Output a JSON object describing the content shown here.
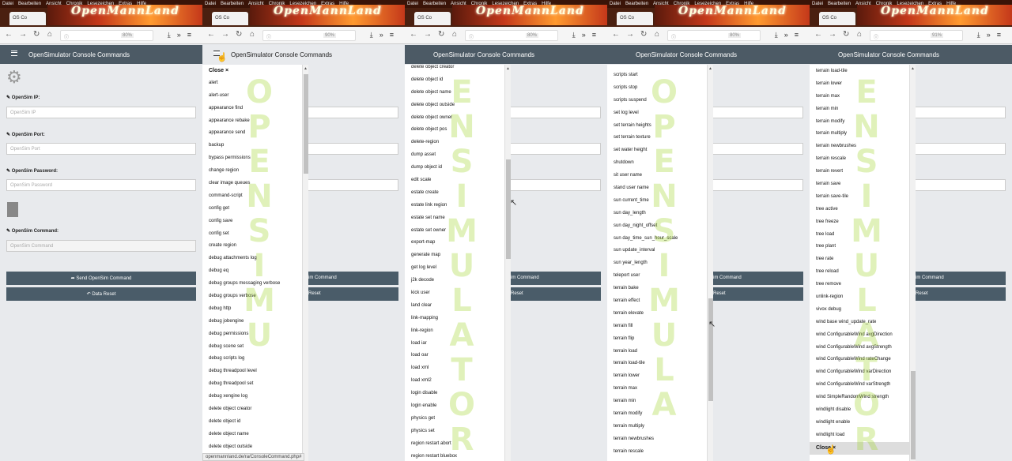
{
  "browser": {
    "menu": [
      "Datei",
      "Bearbeiten",
      "Ansicht",
      "Chronik",
      "Lesezeichen",
      "Extras",
      "Hilfe"
    ],
    "banner": "OpenMannLand",
    "tab_title": "OS Co",
    "zoom_levels": [
      "80%",
      "90%",
      "80%",
      "80%",
      "91%"
    ],
    "status_url": "openmannland.de/ra/ConsoleCommand.php#"
  },
  "app": {
    "title": "OpenSimulator Console Commands"
  },
  "form": {
    "ip_label": "OpenSim IP:",
    "ip_placeholder": "OpenSim IP",
    "port_label": "OpenSim Port:",
    "port_placeholder": "OpenSim Port",
    "password_label": "OpenSim Password:",
    "password_placeholder": "OpenSim Password",
    "command_label": "OpenSim Command:",
    "command_placeholder": "OpenSim Command",
    "send_button": "Send OpenSim Command",
    "reset_button": "Data Reset",
    "send_button_partial": "im Command",
    "reset_button_partial": "Reset"
  },
  "watermark": "OPENSIMULATOR",
  "nav": {
    "close_label": "Close ×",
    "col1": [
      "alert",
      "alert-user",
      "appearance find",
      "appearance rebake",
      "appearance send",
      "backup",
      "bypass permissions",
      "change region",
      "clear image queues",
      "command-script",
      "config get",
      "config save",
      "config set",
      "create region",
      "debug attachments log",
      "debug eq",
      "debug groups messaging verbose",
      "debug groups verbose",
      "debug http",
      "debug jobengine",
      "debug permissions",
      "debug scene set",
      "debug scripts log",
      "debug threadpool level",
      "debug threadpool set",
      "debug xengine log",
      "delete object creator",
      "delete object id",
      "delete object name",
      "delete object outside"
    ],
    "col2": [
      "delete object creator",
      "delete object id",
      "delete object name",
      "delete object outside",
      "delete object owner",
      "delete object pos",
      "delete-region",
      "dump asset",
      "dump object id",
      "edit scale",
      "estate create",
      "estate link region",
      "estate set name",
      "estate set owner",
      "export-map",
      "generate map",
      "get log level",
      "j2k decode",
      "kick user",
      "land clear",
      "link-mapping",
      "link-region",
      "load iar",
      "load oar",
      "load xml",
      "load xml2",
      "login disable",
      "login enable",
      "physics get",
      "physics set",
      "region restart abort",
      "region restart bluebox"
    ],
    "col3": [
      "scripts start",
      "scripts stop",
      "scripts suspend",
      "set log level",
      "set terrain heights",
      "set terrain texture",
      "set water height",
      "shutdown",
      "sit user name",
      "stand user name",
      "sun current_time",
      "sun day_length",
      "sun day_night_offset",
      "sun day_time_sun_hour_scale",
      "sun update_interval",
      "sun year_length",
      "teleport user",
      "terrain bake",
      "terrain effect",
      "terrain elevate",
      "terrain fill",
      "terrain flip",
      "terrain load",
      "terrain load-tile",
      "terrain lower",
      "terrain max",
      "terrain min",
      "terrain modify",
      "terrain multiply",
      "terrain newbrushes",
      "terrain rescale"
    ],
    "col4": [
      "terrain load-tile",
      "terrain lower",
      "terrain max",
      "terrain min",
      "terrain modify",
      "terrain multiply",
      "terrain newbrushes",
      "terrain rescale",
      "terrain revert",
      "terrain save",
      "terrain save-tile",
      "tree active",
      "tree freeze",
      "tree load",
      "tree plant",
      "tree rate",
      "tree reload",
      "tree remove",
      "unlink-region",
      "vivox debug",
      "wind base wind_update_rate",
      "wind ConfigurableWind avgDirection",
      "wind ConfigurableWind avgStrength",
      "wind ConfigurableWind rateChange",
      "wind ConfigurableWind varDirection",
      "wind ConfigurableWind varStrength",
      "wind SimpleRandomWind strength",
      "windlight disable",
      "windlight enable",
      "windlight load"
    ]
  }
}
